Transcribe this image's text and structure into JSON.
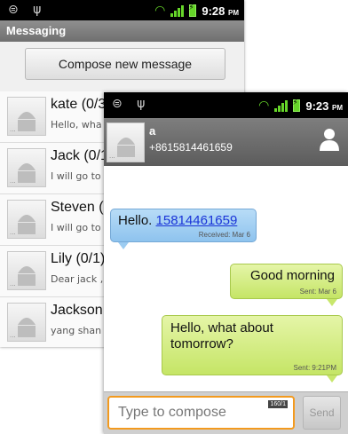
{
  "list_screen": {
    "status_time": "9:28",
    "status_ampm": "PM",
    "title": "Messaging",
    "compose_label": "Compose new message",
    "conversations": [
      {
        "name": "kate (0/3",
        "snippet": "Hello, wha"
      },
      {
        "name": "Jack (0/1",
        "snippet": "I will go to"
      },
      {
        "name": "Steven (0",
        "snippet": "I will go to"
      },
      {
        "name": "Lily (0/1)",
        "snippet": "Dear jack ,"
      },
      {
        "name": "Jackson (",
        "snippet": "yang shan"
      }
    ]
  },
  "conversation_screen": {
    "status_time": "9:23",
    "status_ampm": "PM",
    "contact_name": "a",
    "contact_number": "+8615814461659",
    "messages": [
      {
        "direction": "in",
        "text": "Hello.",
        "link": "15814461659",
        "meta": "Received: Mar 6"
      },
      {
        "direction": "out",
        "text": "Good morning",
        "meta": "Sent: Mar 6"
      },
      {
        "direction": "out",
        "text": "Hello, what about tomorrow?",
        "meta": "Sent: 9:21PM"
      }
    ],
    "input_placeholder": "Type to compose",
    "counter": "160/1",
    "send_label": "Send"
  },
  "colors": {
    "incoming_bubble": "#9cccf1",
    "outgoing_bubble": "#c8e76c",
    "input_focus": "#f39a1e",
    "signal": "#66d629"
  },
  "icons": {
    "status_left": [
      "usb-debug-icon",
      "usb-icon"
    ],
    "status_right": [
      "wifi-icon",
      "signal-icon",
      "battery-charging-icon"
    ],
    "avatar": "android-avatar-icon",
    "contact": "person-icon"
  }
}
